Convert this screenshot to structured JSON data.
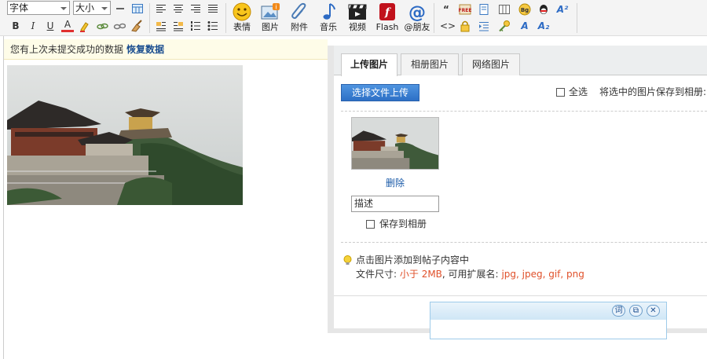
{
  "toolbar": {
    "font_select": "字体",
    "size_select": "大小",
    "buttons": {
      "emoticon": "表情",
      "image": "图片",
      "attachment": "附件",
      "music": "音乐",
      "video": "视频",
      "flash": "Flash",
      "mention": "@朋友"
    },
    "format_row2": {
      "bold": "B",
      "italic": "I",
      "underline": "U",
      "font_color": "A"
    }
  },
  "notice": {
    "text": "您有上次未提交成功的数据",
    "restore_link": "恢复数据"
  },
  "dialog": {
    "tabs": [
      "上传图片",
      "相册图片",
      "网络图片"
    ],
    "upload_button": "选择文件上传",
    "select_all": "全选",
    "save_selected": "将选中的图片保存到相册:",
    "delete_link": "删除",
    "description_value": "描述",
    "save_to_album": "保存到相册",
    "tip": "点击图片添加到帖子内容中",
    "file_size_label": "文件尺寸:",
    "file_size_value": "小于 2MB",
    "ext_label": ", 可用扩展名:",
    "ext_value": "jpg, jpeg, gif, png"
  },
  "mini_panel": {
    "btn_word": "词"
  }
}
